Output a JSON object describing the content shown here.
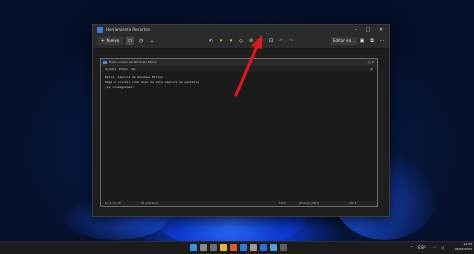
{
  "window": {
    "title": "Herramienta Recortes",
    "controls": [
      "–",
      "□",
      "✕"
    ]
  },
  "toolbar": {
    "new_label": "Nuevo",
    "save_share_label": "Editar en...",
    "items": [
      {
        "name": "snip-mode-icon",
        "glyph": "▭"
      },
      {
        "name": "timer-icon",
        "glyph": "◷"
      },
      {
        "name": "touch-write-icon",
        "glyph": "✍"
      },
      {
        "name": "ballpoint-pen-icon",
        "glyph": "▾"
      },
      {
        "name": "highlighter-icon",
        "glyph": "▾"
      },
      {
        "name": "eraser-icon",
        "glyph": "◇"
      },
      {
        "name": "ruler-icon",
        "glyph": "⊘"
      },
      {
        "name": "crop-icon",
        "glyph": "⌗"
      },
      {
        "name": "text-actions-icon",
        "glyph": "⊡"
      },
      {
        "name": "undo-icon",
        "glyph": "↶"
      },
      {
        "name": "redo-icon",
        "glyph": "↷"
      }
    ]
  },
  "notepad": {
    "title": "Hello, Lorem ep Windows Millos",
    "menu": [
      "Archivo",
      "Editar",
      "Ver"
    ],
    "lines": [
      "Hello, Captura de Windows Millos",
      "Hago a clicker como Usar de esta captura de pantalla",
      "¡Lo conseguimos!"
    ],
    "status": {
      "position": "Lín 3, Col 18",
      "chars": "85 caracteres",
      "zoom": "100%",
      "eol": "Windows (CRLF)",
      "encoding": "UTF-8"
    }
  },
  "taskbar": {
    "time": "10:55",
    "date": "05/05/2022",
    "lang": "ESP"
  },
  "colors": {
    "accent": "#3d7bd9",
    "arrow": "#e0161b"
  }
}
